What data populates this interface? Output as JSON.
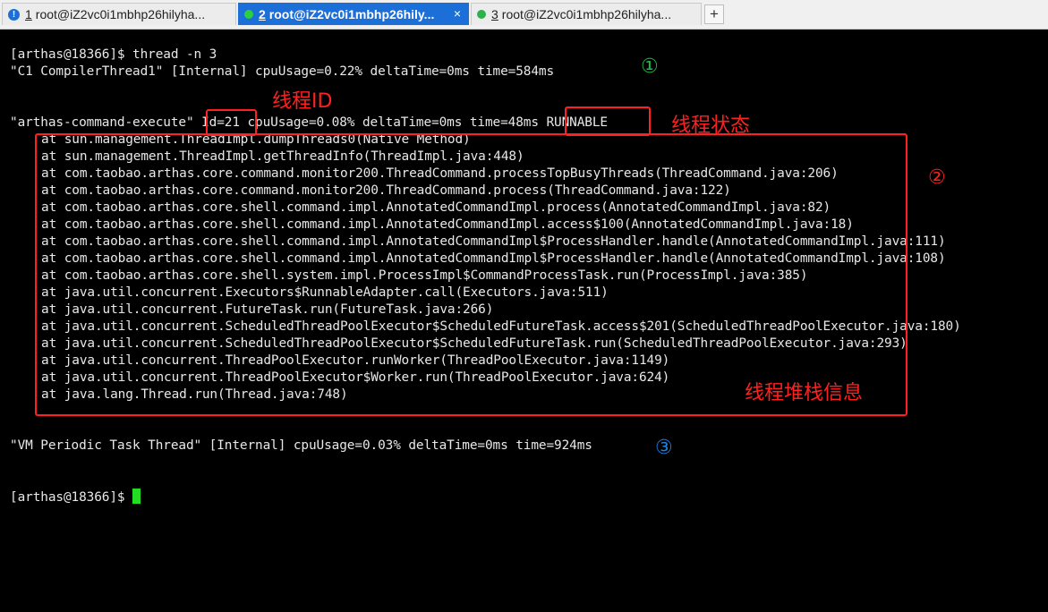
{
  "tabs": [
    {
      "number": "1",
      "title": "root@iZ2vc0i1mbhp26hilyha...",
      "status_icon": "info-icon",
      "status_color": "#1d6fd8",
      "active": false
    },
    {
      "number": "2",
      "title": "root@iZ2vc0i1mbhp26hily...",
      "status_icon": "status-dot-icon",
      "status_color": "#2bcf3f",
      "active": true,
      "close": "×"
    },
    {
      "number": "3",
      "title": "root@iZ2vc0i1mbhp26hilyha...",
      "status_icon": "status-dot-icon",
      "status_color": "#2bb24c",
      "active": false
    }
  ],
  "new_tab_label": "+",
  "info_glyph": "!",
  "terminal": {
    "command_line": "[arthas@18366]$ thread -n 3",
    "thread1_line": "\"C1 CompilerThread1\" [Internal] cpuUsage=0.22% deltaTime=0ms time=584ms",
    "thread2_line": "\"arthas-command-execute\" Id=21 cpuUsage=0.08% deltaTime=0ms time=48ms RUNNABLE",
    "stack_trace": [
      "at sun.management.ThreadImpl.dumpThreads0(Native Method)",
      "at sun.management.ThreadImpl.getThreadInfo(ThreadImpl.java:448)",
      "at com.taobao.arthas.core.command.monitor200.ThreadCommand.processTopBusyThreads(ThreadCommand.java:206)",
      "at com.taobao.arthas.core.command.monitor200.ThreadCommand.process(ThreadCommand.java:122)",
      "at com.taobao.arthas.core.shell.command.impl.AnnotatedCommandImpl.process(AnnotatedCommandImpl.java:82)",
      "at com.taobao.arthas.core.shell.command.impl.AnnotatedCommandImpl.access$100(AnnotatedCommandImpl.java:18)",
      "at com.taobao.arthas.core.shell.command.impl.AnnotatedCommandImpl$ProcessHandler.handle(AnnotatedCommandImpl.java:111)",
      "at com.taobao.arthas.core.shell.command.impl.AnnotatedCommandImpl$ProcessHandler.handle(AnnotatedCommandImpl.java:108)",
      "at com.taobao.arthas.core.shell.system.impl.ProcessImpl$CommandProcessTask.run(ProcessImpl.java:385)",
      "at java.util.concurrent.Executors$RunnableAdapter.call(Executors.java:511)",
      "at java.util.concurrent.FutureTask.run(FutureTask.java:266)",
      "at java.util.concurrent.ScheduledThreadPoolExecutor$ScheduledFutureTask.access$201(ScheduledThreadPoolExecutor.java:180)",
      "at java.util.concurrent.ScheduledThreadPoolExecutor$ScheduledFutureTask.run(ScheduledThreadPoolExecutor.java:293)",
      "at java.util.concurrent.ThreadPoolExecutor.runWorker(ThreadPoolExecutor.java:1149)",
      "at java.util.concurrent.ThreadPoolExecutor$Worker.run(ThreadPoolExecutor.java:624)",
      "at java.lang.Thread.run(Thread.java:748)"
    ],
    "thread3_line": "\"VM Periodic Task Thread\" [Internal] cpuUsage=0.03% deltaTime=0ms time=924ms",
    "prompt": "[arthas@18366]$ "
  },
  "annotations": {
    "thread_id_label": "线程ID",
    "thread_state_label": "线程状态",
    "stack_info_label": "线程堆栈信息",
    "marker_1": "①",
    "marker_2": "②",
    "marker_3": "③",
    "marker_1_color": "#1fb84a",
    "marker_2_color": "#ff2020",
    "marker_3_color": "#1d7fe0",
    "highlight_color": "#ff2020"
  },
  "colors": {
    "terminal_bg": "#000000",
    "terminal_fg": "#e8e8e8",
    "cursor": "#22dd22",
    "active_tab": "#1d6fd8"
  }
}
